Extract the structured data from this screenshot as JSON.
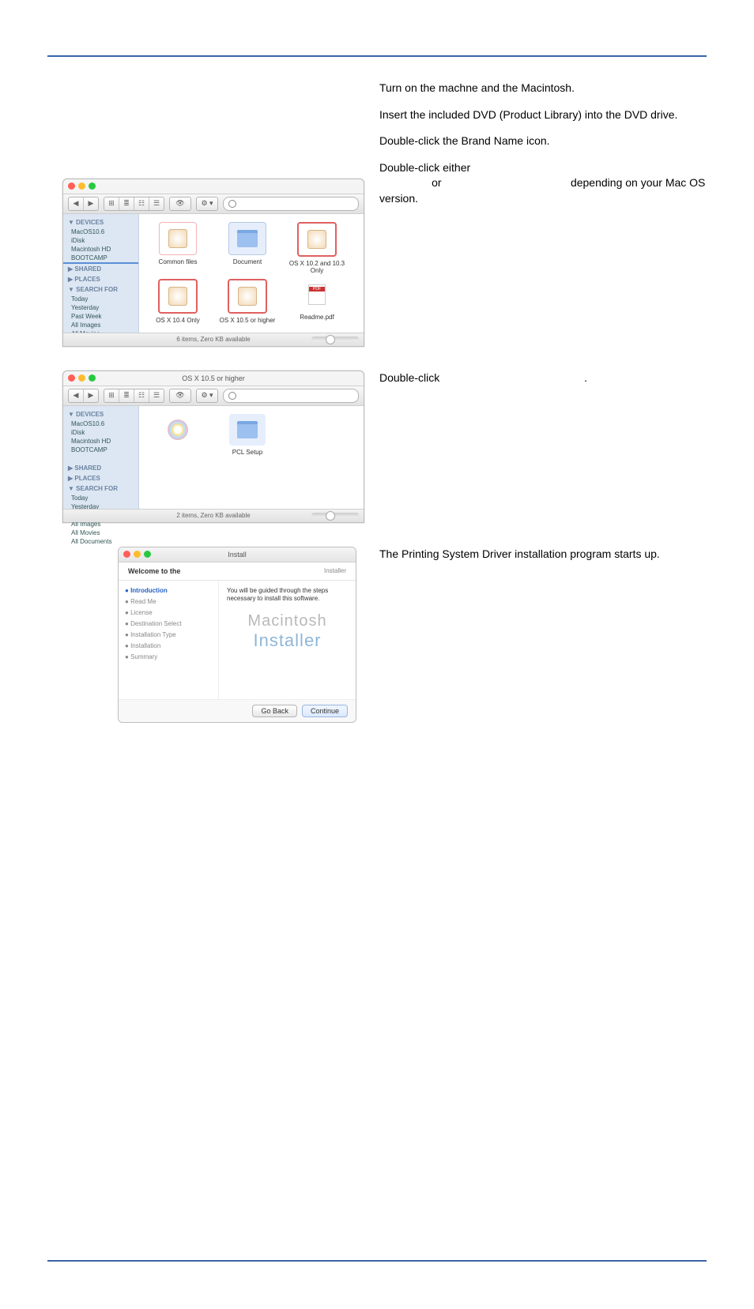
{
  "steps": {
    "s1": "Turn on the machne and the Macintosh.",
    "s2": "Insert the included DVD (Product Library) into the DVD drive.",
    "s3": "Double-click the Brand Name icon.",
    "s4a": "Double-click either",
    "s4b": "or",
    "s4c": "depending on your Mac OS version.",
    "s5a": "Double-click",
    "s5b": ".",
    "s6": "The Printing System Driver installation program starts up."
  },
  "finder1": {
    "title": "",
    "nav_back": "◀",
    "nav_fwd": "▶",
    "view1": "⊞",
    "view2": "≣",
    "view3": "☷",
    "view4": "☰",
    "eye": "👁",
    "gear": "⚙ ▾",
    "search_placeholder": "",
    "sidebar": {
      "devices_hdr": "▼ DEVICES",
      "d1": "MacOS10.6",
      "d2": "iDisk",
      "d3": "Macintosh HD",
      "d4": "BOOTCAMP",
      "d5": "",
      "shared_hdr": "▶ SHARED",
      "places_hdr": "▶ PLACES",
      "search_hdr": "▼ SEARCH FOR",
      "sf1": "Today",
      "sf2": "Yesterday",
      "sf3": "Past Week",
      "sf4": "All Images",
      "sf5": "All Movies",
      "sf6": "All Documents"
    },
    "files": {
      "f1": "Common files",
      "f2": "Document",
      "f3": "OS X 10.2 and 10.3 Only",
      "f4": "OS X 10.4 Only",
      "f5": "OS X 10.5 or higher",
      "f6": "Readme.pdf"
    },
    "status": "6 items, Zero KB available"
  },
  "finder2": {
    "title": "OS X 10.5 or higher",
    "files": {
      "f1": "",
      "f2": "PCL Setup"
    },
    "status": "2 items, Zero KB available"
  },
  "installer": {
    "titlebar": "Install",
    "welcome": "Welcome to the",
    "welcome_sub": "Installer",
    "steps": {
      "s1": "Introduction",
      "s2": "Read Me",
      "s3": "License",
      "s4": "Destination Select",
      "s5": "Installation Type",
      "s6": "Installation",
      "s7": "Summary"
    },
    "msg": "You will be guided through the steps necessary to install this software.",
    "big1": "Macintosh",
    "big2": "Installer",
    "btn_back": "Go Back",
    "btn_continue": "Continue"
  }
}
